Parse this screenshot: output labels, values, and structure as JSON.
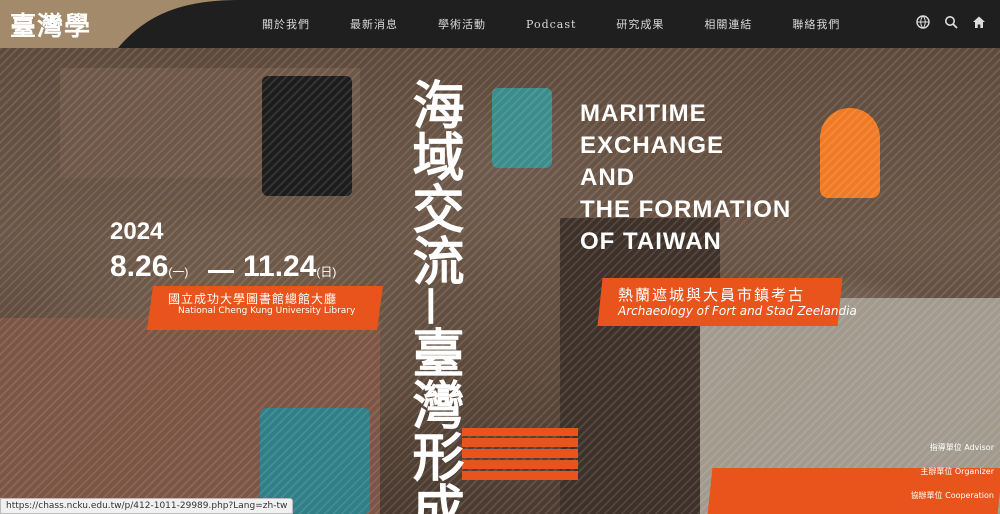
{
  "header": {
    "logo_text": "臺灣學",
    "nav": [
      "關於我們",
      "最新消息",
      "學術活動",
      "Podcast",
      "研究成果",
      "相關連結",
      "聯絡我們"
    ],
    "icons": [
      "globe-icon",
      "search-icon",
      "home-icon"
    ]
  },
  "hero": {
    "zh_title_1": "海域交流",
    "zh_dash": "—",
    "zh_title_2": "臺灣形成",
    "en_title": [
      "MARITIME",
      "EXCHANGE",
      "AND",
      "THE FORMATION",
      "OF TAIWAN"
    ],
    "subtitle_zh": "熱蘭遮城與大員市鎮考古",
    "subtitle_en": "Archaeology of Fort and Stad Zeelandia",
    "year": "2024",
    "start_date": "8.26",
    "start_day": "(一)",
    "end_date": "11.24",
    "end_day": "(日)",
    "venue_zh": "國立成功大學圖書館總館大廳",
    "venue_en": "National Cheng Kung University Library",
    "credits": [
      "指導單位 Advisor",
      "主辦單位 Organizer",
      "協辦單位 Cooperation"
    ]
  },
  "status_url": "https://chass.ncku.edu.tw/p/412-1011-29989.php?Lang=zh-tw",
  "colors": {
    "accent": "#e8541c",
    "nav_bg": "#1f1f1f",
    "logo_bg": "#a38a6a"
  }
}
